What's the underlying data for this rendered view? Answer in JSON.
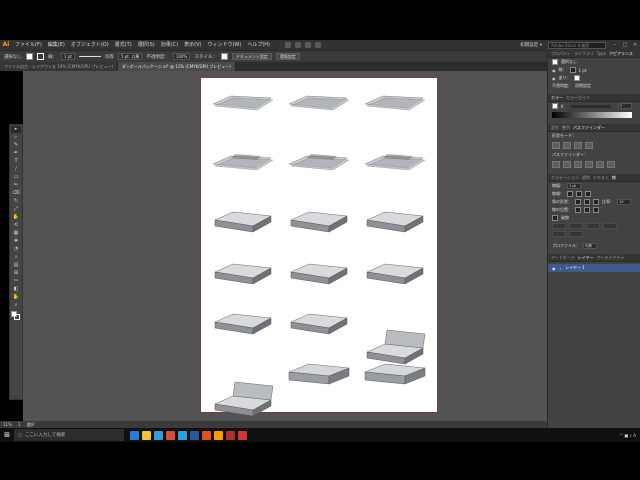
{
  "app": {
    "logo": "Ai",
    "menu": [
      "ファイル(F)",
      "編集(E)",
      "オブジェクト(O)",
      "書式(T)",
      "選択(S)",
      "効果(C)",
      "表示(V)",
      "ウィンドウ(W)",
      "ヘルプ(H)"
    ],
    "workspace": "初期設定 ▾",
    "stock_search_placeholder": "Adobe Stock を検索",
    "window_controls": [
      "–",
      "□",
      "×"
    ]
  },
  "control_bar": {
    "selection_label": "選択なし",
    "stroke_label": "線：",
    "stroke_weight": "1 pt",
    "profile_label": "均等",
    "brush_label": "5 pt. 丸筆",
    "opacity_label": "不透明度：",
    "opacity_value": "100%",
    "style_label": "スタイル：",
    "doc_setup_button": "ドキュメント設定",
    "prefs_button": "環境設定"
  },
  "tabs": [
    {
      "label": "ファイル出力 - レイアウト＆ 19% (CMYK/GPU プレビュー)",
      "active": false
    },
    {
      "label": "ダンボールパッケージ.ai* @ 11% (CMYK/GPU プレビュー)",
      "active": true
    }
  ],
  "tools": [
    "▸",
    "▹",
    "✎",
    "✒",
    "T",
    "/",
    "▭",
    "✏",
    "⌫",
    "↻",
    "⤢",
    "✋",
    "⟲",
    "▦",
    "✚",
    "◔",
    "⌕",
    "▤",
    "⊞",
    "✂",
    "◧",
    "✋",
    "⌕"
  ],
  "status": {
    "zoom": "11%",
    "page": "1",
    "mode": "選択"
  },
  "panels": {
    "top_tabs": [
      "プロパティ",
      "ライブラリ",
      "Typo",
      "アピアランス"
    ],
    "appearance": {
      "title": "選択なし",
      "stroke_label": "線：",
      "stroke_value": "1 pt",
      "fill_label": "塗り：",
      "opacity_label": "不透明度：",
      "opacity_value": "初期設定"
    },
    "color_tabs": [
      "カラー",
      "カラーガイド"
    ],
    "color_k_label": "K",
    "color_k_value": "0",
    "transform_tabs": [
      "変形",
      "整列",
      "パスファインダー"
    ],
    "shape_modes_label": "形状モード：",
    "pathfinder_label": "パスファインダー：",
    "type_tabs": [
      "グラデーション",
      "透明",
      "テキスト",
      "線"
    ],
    "stroke_panel": {
      "weight_label": "線幅：",
      "weight_value": "1 pt",
      "cap_label": "線端：",
      "corner_label": "角の形状：",
      "limit_label": "比率：",
      "limit_value": "10",
      "align_label": "線の位置：",
      "dashed_label": "破線",
      "profile_label": "プロファイル：",
      "profile_value": "均等"
    },
    "layer_tabs": [
      "アートボード",
      "レイヤー",
      "アーキテクチャ"
    ],
    "layer_name": "レイヤー 1"
  },
  "taskbar": {
    "search_placeholder": "ここに入力して検索",
    "apps": [
      "#2a7bd6",
      "#f0c040",
      "#3a9ad9",
      "#d84a3a",
      "#2ea0e0",
      "#2b579a",
      "#e05020",
      "#ff9a00",
      "#b0302a",
      "#d03838"
    ],
    "tray_time": "",
    "tray": "^ ■ ♪ A"
  }
}
